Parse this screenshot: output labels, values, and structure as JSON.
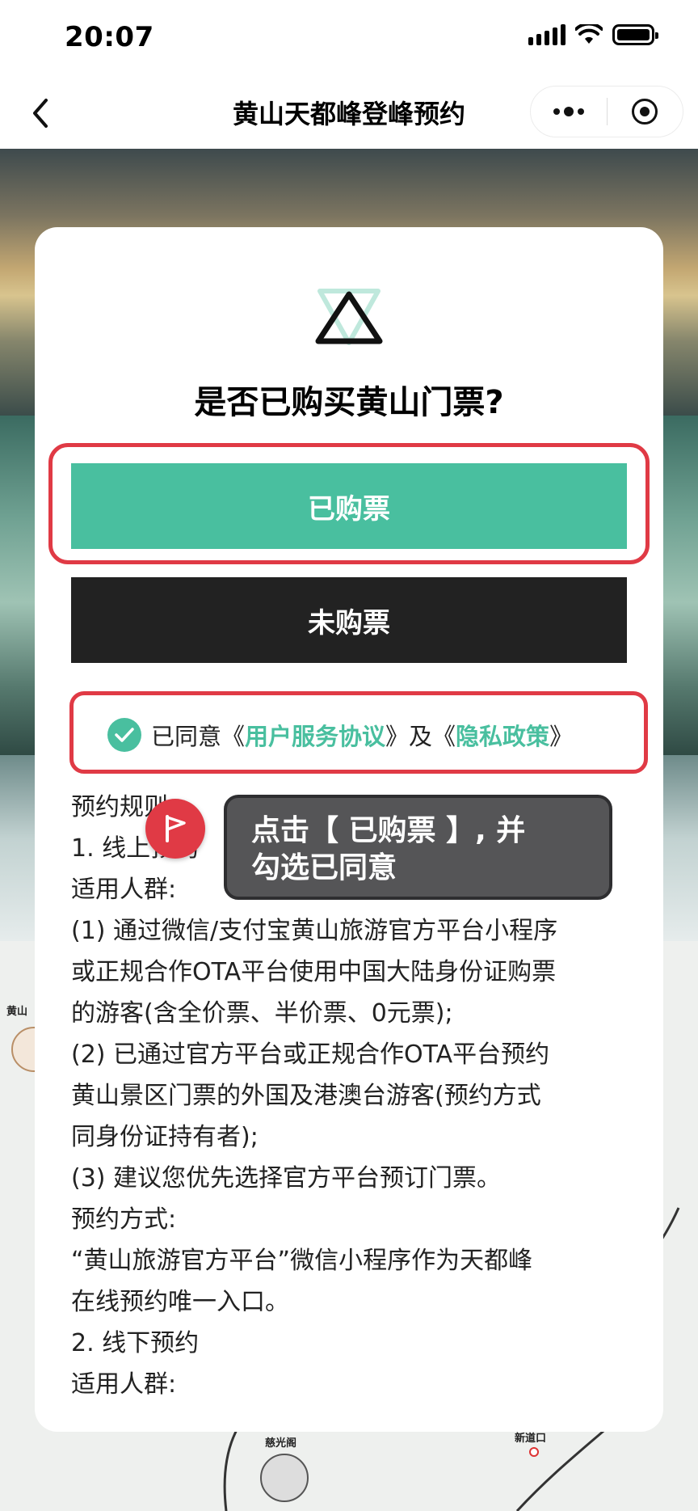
{
  "status_bar": {
    "time": "20:07"
  },
  "nav": {
    "title": "黄山天都峰登峰预约"
  },
  "modal": {
    "title": "是否已购买黄山门票?",
    "bought_button": "已购票",
    "not_bought_button": "未购票",
    "agreement": {
      "prefix": "已同意《",
      "service_link": "用户服务协议",
      "middle": "》及《",
      "privacy_link": "隐私政策",
      "suffix": "》",
      "checked": true
    },
    "rules": [
      "预约规则",
      "1. 线上预约",
      "适用人群:",
      "(1) 通过微信/支付宝黄山旅游官方平台小程序",
      "或正规合作OTA平台使用中国大陆身份证购票",
      "的游客(含全价票、半价票、0元票);",
      "(2) 已通过官方平台或正规合作OTA平台预约",
      "黄山景区门票的外国及港澳台游客(预约方式",
      "同身份证持有者);",
      "(3) 建议您优先选择官方平台预订门票。",
      "预约方式:",
      "“黄山旅游官方平台”微信小程序作为天都峰",
      "在线预约唯一入口。",
      "2. 线下预约",
      "适用人群:"
    ]
  },
  "tooltip": {
    "line1": "点击【 已购票 】, 并",
    "line2": "勾选已同意"
  },
  "map": {
    "label_left": "黄山",
    "label_ciguang": "慈光阁",
    "label_xindao": "新道口"
  },
  "colors": {
    "accent_green": "#49bf9f",
    "dark_button": "#222222",
    "highlight_red": "#e03a45",
    "tooltip_bg": "#555557"
  },
  "icons": {
    "back": "chevron-left-icon",
    "more": "more-dots-icon",
    "target": "target-icon",
    "logo": "triangle-logo-icon",
    "check": "check-icon",
    "flag": "flag-icon"
  }
}
